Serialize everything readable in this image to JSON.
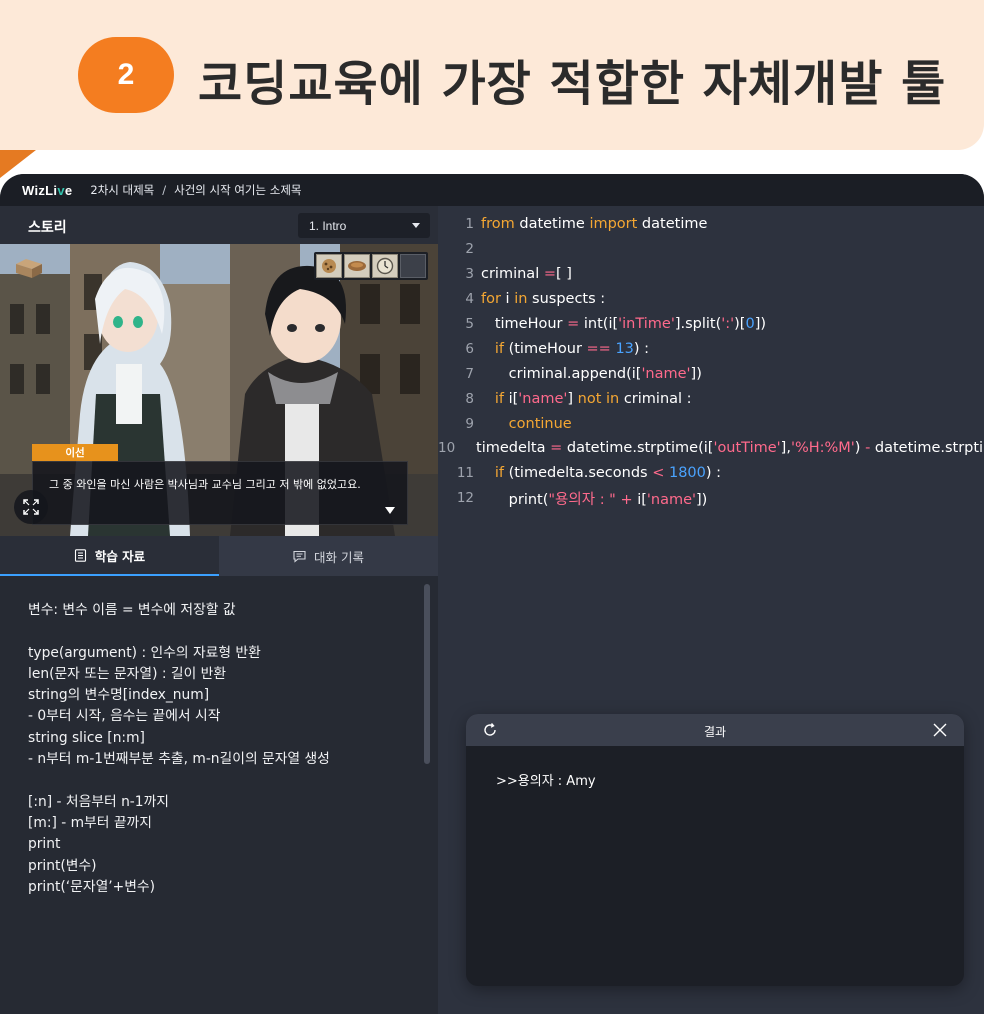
{
  "banner": {
    "number": "2",
    "title": "코딩교육에 가장 적합한 자체개발 툴"
  },
  "topbar": {
    "logo_main": "WizLi",
    "logo_accent": "v",
    "logo_end": "e",
    "chapter": "2차시 대제목",
    "separator": "/",
    "subtitle": "사건의 시작 여기는 소제목"
  },
  "story": {
    "title": "스토리",
    "episode": "1. Intro",
    "speaker": "이선",
    "dialog": "그 중 와인을 마신 사람은 박사님과 교수님 그리고 저 밖에 없었고요."
  },
  "tabs": [
    {
      "label": "학습 자료",
      "icon": "document-icon",
      "active": true
    },
    {
      "label": "대화 기록",
      "icon": "chat-icon",
      "active": false
    }
  ],
  "materials": {
    "text": "변수: 변수 이름 = 변수에 저장할 값\n\ntype(argument) : 인수의 자료형 반환\nlen(문자 또는 문자열) : 길이 반환\nstring의 변수명[index_num]\n- 0부터 시작, 음수는 끝에서 시작\nstring slice [n:m]\n- n부터 m-1번째부분 추출, m-n길이의 문자열 생성\n\n[:n] - 처음부터 n-1까지\n[m:] - m부터 끝까지\nprint\nprint(변수)\nprint(‘문자열’+변수)"
  },
  "code": {
    "lines": [
      {
        "n": "1",
        "tokens": [
          [
            "kw",
            "from"
          ],
          [
            "t",
            " datetime "
          ],
          [
            "kw",
            "import"
          ],
          [
            "t",
            " datetime"
          ]
        ]
      },
      {
        "n": "2",
        "tokens": []
      },
      {
        "n": "3",
        "tokens": [
          [
            "t",
            "criminal "
          ],
          [
            "op",
            "="
          ],
          [
            "t",
            "[ ]"
          ]
        ]
      },
      {
        "n": "4",
        "tokens": [
          [
            "kw",
            "for"
          ],
          [
            "t",
            " i "
          ],
          [
            "kw",
            "in"
          ],
          [
            "t",
            " suspects :"
          ]
        ]
      },
      {
        "n": "5",
        "tokens": [
          [
            "t",
            "   timeHour "
          ],
          [
            "op",
            "="
          ],
          [
            "t",
            " int(i["
          ],
          [
            "str",
            "'inTime'"
          ],
          [
            "t",
            "].split("
          ],
          [
            "str",
            "':'"
          ],
          [
            "t",
            ")["
          ],
          [
            "num",
            "0"
          ],
          [
            "t",
            "])"
          ]
        ]
      },
      {
        "n": "6",
        "tokens": [
          [
            "t",
            "   "
          ],
          [
            "kw",
            "if"
          ],
          [
            "t",
            " (timeHour "
          ],
          [
            "op",
            "=="
          ],
          [
            "t",
            " "
          ],
          [
            "num",
            "13"
          ],
          [
            "t",
            ") :"
          ]
        ]
      },
      {
        "n": "7",
        "tokens": [
          [
            "t",
            "      criminal.append(i["
          ],
          [
            "str",
            "'name'"
          ],
          [
            "t",
            "])"
          ]
        ]
      },
      {
        "n": "8",
        "tokens": [
          [
            "t",
            "   "
          ],
          [
            "kw",
            "if"
          ],
          [
            "t",
            " i["
          ],
          [
            "str",
            "'name'"
          ],
          [
            "t",
            "] "
          ],
          [
            "kw",
            "not in"
          ],
          [
            "t",
            " criminal :"
          ]
        ]
      },
      {
        "n": "9",
        "tokens": [
          [
            "t",
            "      "
          ],
          [
            "kw",
            "continue"
          ]
        ]
      },
      {
        "n": "10",
        "tokens": [
          [
            "t",
            "   timedelta "
          ],
          [
            "op",
            "="
          ],
          [
            "t",
            " datetime.strptime(i["
          ],
          [
            "str",
            "'outTime'"
          ],
          [
            "t",
            "],"
          ],
          [
            "str",
            "'%H:%M'"
          ],
          [
            "t",
            ") "
          ],
          [
            "op",
            "-"
          ],
          [
            "t",
            " datetime.strptime(i"
          ]
        ]
      },
      {
        "n": "11",
        "tokens": [
          [
            "t",
            "   "
          ],
          [
            "kw",
            "if"
          ],
          [
            "t",
            " (timedelta.seconds "
          ],
          [
            "op",
            "<"
          ],
          [
            "t",
            " "
          ],
          [
            "num",
            "1800"
          ],
          [
            "t",
            ") :"
          ]
        ]
      },
      {
        "n": "12",
        "tokens": [
          [
            "t",
            "      print("
          ],
          [
            "str",
            "\"용의자 : \""
          ],
          [
            "t",
            " "
          ],
          [
            "op",
            "+"
          ],
          [
            "t",
            " i["
          ],
          [
            "str",
            "'name'"
          ],
          [
            "t",
            "])"
          ]
        ]
      }
    ]
  },
  "result": {
    "title": "결과",
    "output": ">>용의자 : Amy"
  },
  "icons": {
    "inventory": [
      "cookie-icon",
      "bread-icon",
      "clock-icon",
      "empty-slot"
    ]
  },
  "colors": {
    "accent_orange": "#f47d20",
    "keyword": "#f4a733",
    "string": "#ff6a8c",
    "number": "#4aa3ff",
    "tab_active": "#3ba0ff"
  }
}
